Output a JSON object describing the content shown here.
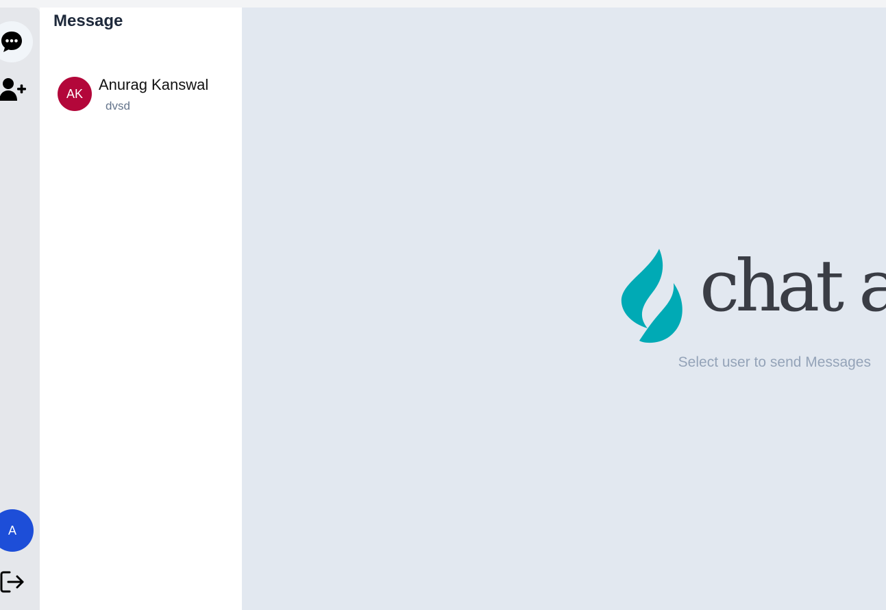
{
  "sidebar": {
    "chat_icon": "chat-bubble-ellipsis-icon",
    "add_user_icon": "user-plus-icon",
    "avatar_initial": "A",
    "logout_icon": "logout-icon"
  },
  "panel": {
    "title": "Message",
    "contacts": [
      {
        "initials": "AK",
        "name": "Anurag Kanswal",
        "last_message": "dvsd",
        "avatar_color": "#b3073a"
      }
    ]
  },
  "main": {
    "logo_text": "chat ap",
    "hint": "Select user to send Messages"
  },
  "colors": {
    "accent": "#1d4ed8",
    "brand_teal": "#00aab5",
    "main_bg": "#e2e8f0"
  }
}
